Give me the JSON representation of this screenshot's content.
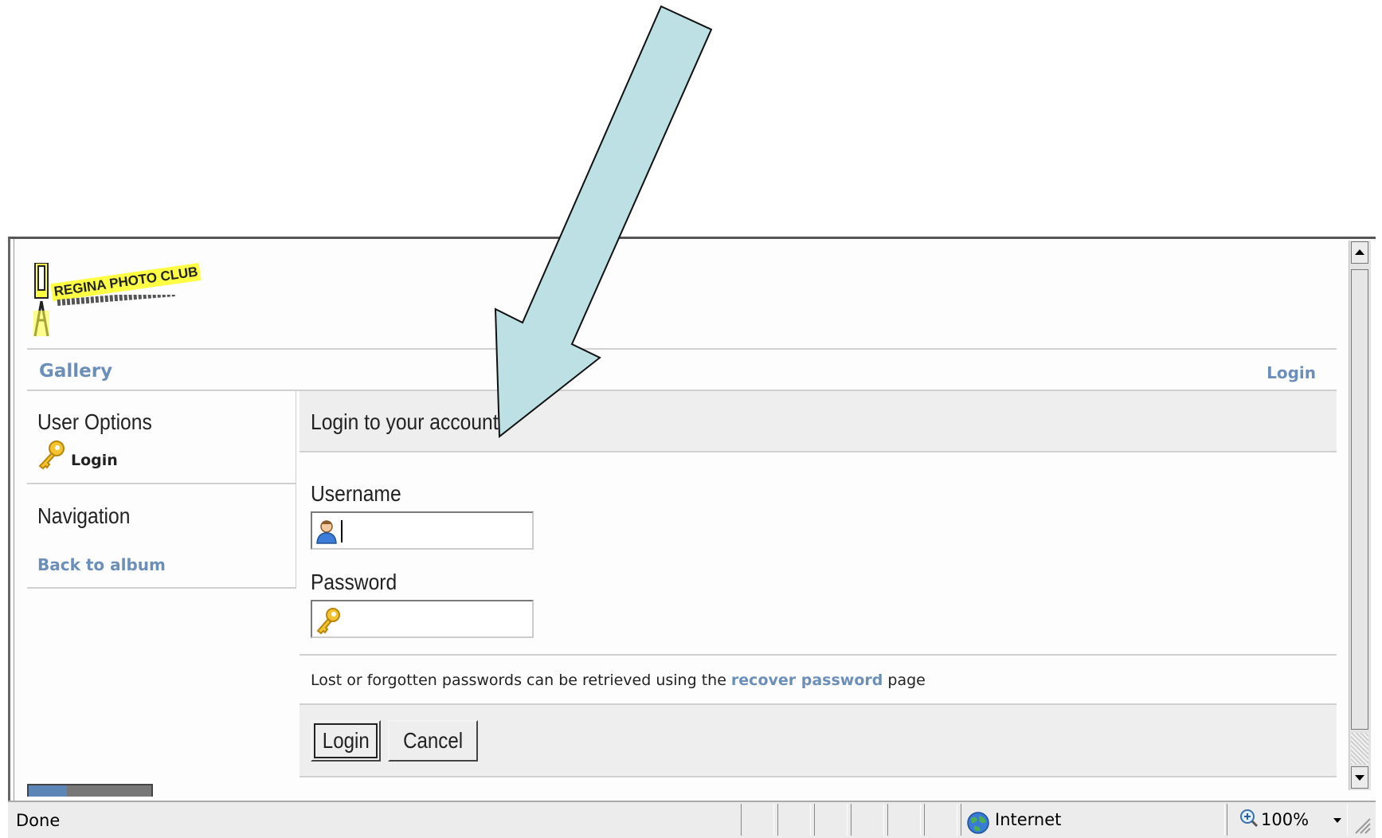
{
  "header": {
    "logo_text": "REGINA PHOTO CLUB",
    "nav_gallery": "Gallery",
    "nav_login": "Login"
  },
  "sidebar": {
    "user_options_title": "User Options",
    "login_link": "Login",
    "navigation_title": "Navigation",
    "back_link": "Back to album"
  },
  "main": {
    "title": "Login to your account",
    "username_label": "Username",
    "password_label": "Password",
    "recover_prefix": "Lost or forgotten passwords can be retrieved using the ",
    "recover_link": "recover password",
    "recover_suffix": " page",
    "login_button": "Login",
    "cancel_button": "Cancel"
  },
  "statusbar": {
    "status": "Done",
    "zone": "Internet",
    "zoom": "100%"
  },
  "colors": {
    "link": "#6b8fb8",
    "arrow_fill": "#bde0e4",
    "panel_bg": "#eeeeee"
  },
  "icons": [
    "user-icon",
    "key-icon",
    "globe-icon",
    "zoom-icon",
    "down-arrow-annotation"
  ]
}
